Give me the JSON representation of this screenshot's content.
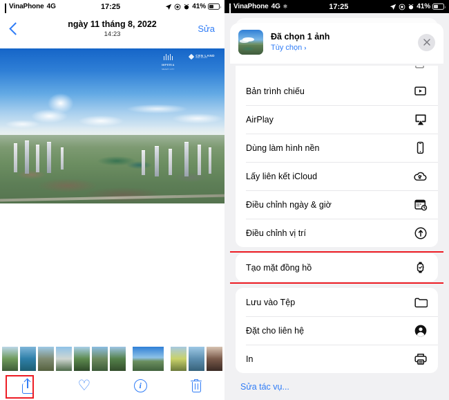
{
  "left_screen": {
    "status_bar": {
      "carrier": "VinaPhone",
      "network": "4G",
      "time": "17:25",
      "battery_percent": "41%",
      "icons": [
        "signal-bars-icon",
        "location-arrow-icon",
        "do-not-disturb-icon",
        "alarm-clock-icon",
        "battery-icon"
      ]
    },
    "nav_bar": {
      "back_label": "back-chevron",
      "date": "ngày 11 tháng 8, 2022",
      "time": "14:23",
      "edit_label": "Sửa"
    },
    "photo": {
      "alt": "Aerial panorama of a city with high-rise towers, lake and blue cloudy sky",
      "watermark_1": "IMPERIA",
      "watermark_1_sub": "SMART CITY",
      "watermark_2": "CEN LAND",
      "watermark_2_sub": "REAL ESTATE"
    },
    "toolbar": {
      "share_label": "share-icon",
      "favorite_label": "heart-icon",
      "info_label": "info-icon",
      "delete_label": "trash-icon",
      "highlighted": "share-icon"
    }
  },
  "right_screen": {
    "status_bar": {
      "carrier": "VinaPhone",
      "network": "4G",
      "time": "17:25",
      "battery_percent": "41%",
      "extra_icon": "snowflake-icon"
    },
    "share_sheet": {
      "title": "Đã chọn 1 ảnh",
      "options_link": "Tùy chọn",
      "options_chevron": "›",
      "close_label": "close-icon",
      "thumbnail": "selected-photo-thumbnail",
      "groups": [
        {
          "items": [
            {
              "label": "Bản trình chiếu",
              "icon": "slideshow-icon"
            },
            {
              "label": "AirPlay",
              "icon": "airplay-icon"
            },
            {
              "label": "Dùng làm hình nền",
              "icon": "wallpaper-phone-icon"
            },
            {
              "label": "Lấy liên kết iCloud",
              "icon": "icloud-link-icon"
            },
            {
              "label": "Điều chỉnh ngày & giờ",
              "icon": "calendar-clock-icon"
            },
            {
              "label": "Điều chỉnh vị trí",
              "icon": "location-adjust-icon"
            }
          ]
        },
        {
          "items": [
            {
              "label": "Tạo mặt đồng hồ",
              "icon": "apple-watch-icon",
              "highlighted": true
            }
          ]
        },
        {
          "items": [
            {
              "label": "Lưu vào Tệp",
              "icon": "folder-icon"
            },
            {
              "label": "Đặt cho liên hệ",
              "icon": "contact-person-icon"
            },
            {
              "label": "In",
              "icon": "printer-icon"
            }
          ]
        }
      ],
      "edit_actions_label": "Sửa tác vụ..."
    }
  },
  "colors": {
    "accent_blue": "#2f7cf6",
    "highlight_red": "#ed1c24",
    "sheet_bg": "#f1f1f3",
    "card_white": "#ffffff",
    "divider": "#e7e7ea"
  }
}
